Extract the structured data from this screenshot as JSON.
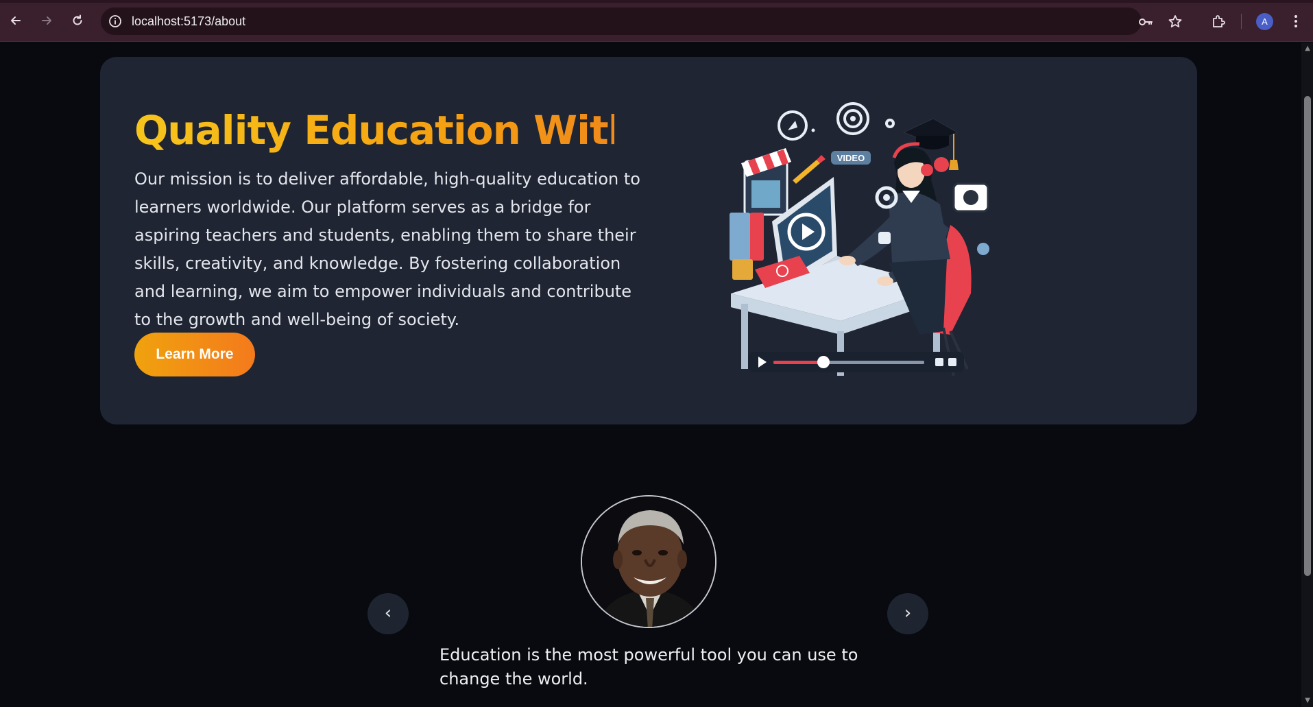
{
  "browser": {
    "url": "localhost:5173/about",
    "profile_initial": "A",
    "icons": [
      "back-arrow-icon",
      "forward-arrow-icon",
      "reload-icon",
      "info-icon",
      "password-key-icon",
      "bookmark-star-icon",
      "extensions-icon",
      "menu-dots-icon"
    ]
  },
  "hero": {
    "title": "Quality Education Withi",
    "description": "Our mission is to deliver affordable, high-quality education to learners worldwide. Our platform serves as a bridge for aspiring teachers and students, enabling them to share their skills, creativity, and knowledge. By fostering collaboration and learning, we aim to empower individuals and contribute to the growth and well-being of society.",
    "button_label": "Learn More",
    "illustration_badge": "VIDEO",
    "colors": {
      "title_start": "#f7c51c",
      "title_end": "#f08a1a",
      "card_bg": "#1f2533",
      "page_bg": "#080a10"
    }
  },
  "testimonial": {
    "prev_label": "‹",
    "next_label": "›",
    "quote": "Education is the most powerful tool you can use to change the world."
  }
}
